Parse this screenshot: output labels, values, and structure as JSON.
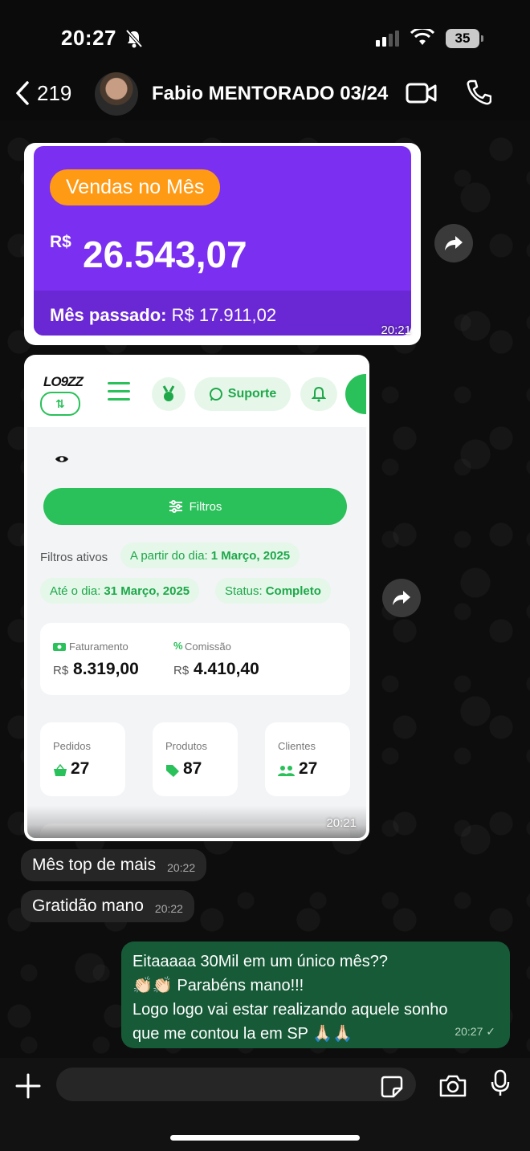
{
  "status_bar": {
    "time": "20:27",
    "battery": "35"
  },
  "header": {
    "back_count": "219",
    "contact_name": "Fabio MENTORADO 03/24"
  },
  "vendas_image": {
    "pill": "Vendas no Mês",
    "currency": "R$",
    "value": "26.543,07",
    "last_label": "Mês passado:",
    "last_value": " R$ 17.911,02",
    "time": "20:21"
  },
  "loggz_image": {
    "logo": "LO9ZZ",
    "swap_icon": "⇅",
    "suporte_label": "Suporte",
    "filtros_label": "Filtros",
    "filtros_ativos": "Filtros ativos",
    "chip_from_label": "A partir do dia:",
    "chip_from_value": "1 Março, 2025",
    "chip_to_label": "Até o dia:",
    "chip_to_value": "31 Março, 2025",
    "chip_status_label": "Status:",
    "chip_status_value": "Completo",
    "faturamento_label": "Faturamento",
    "faturamento_currency": "R$",
    "faturamento_value": "8.319,00",
    "comissao_label": "Comissão",
    "comissao_currency": "R$",
    "comissao_value": "4.410,40",
    "pedidos_label": "Pedidos",
    "pedidos_value": "27",
    "produtos_label": "Produtos",
    "produtos_value": "87",
    "clientes_label": "Clientes",
    "clientes_value": "27",
    "time": "20:21"
  },
  "messages": {
    "in1_text": "Mês top de mais",
    "in1_time": "20:22",
    "in2_text": "Gratidão mano",
    "in2_time": "20:22",
    "out_line1": "Eitaaaaa 30Mil em um único mês??",
    "out_line2": "👏🏻👏🏻 Parabéns mano!!!",
    "out_line3": "Logo logo vai estar realizando aquele sonho",
    "out_line4": "que me contou la em SP 🙏🏻🙏🏻",
    "out_time": "20:27 ✓"
  },
  "composer": {
    "placeholder": ""
  },
  "colors": {
    "purple": "#7b2ff0",
    "orange": "#ff9a14",
    "green": "#2ac05a",
    "outgoing_bubble": "#165a37",
    "incoming_bubble": "#262626"
  }
}
